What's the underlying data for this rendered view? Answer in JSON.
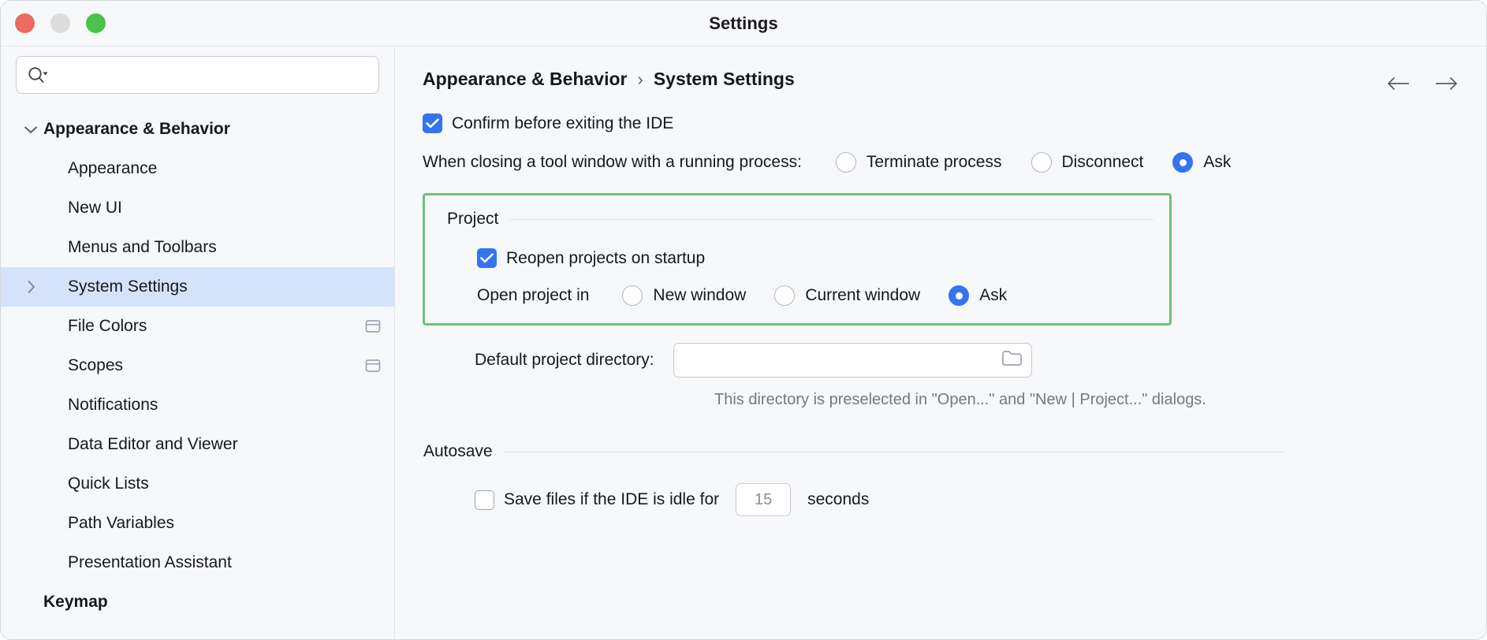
{
  "window": {
    "title": "Settings",
    "controls": {
      "close": "close-button",
      "minimize": "minimize-button",
      "zoom": "zoom-button"
    }
  },
  "sidebar": {
    "search": {
      "value": "",
      "placeholder": ""
    },
    "items": [
      {
        "label": "Appearance & Behavior",
        "level": 0,
        "bold": true,
        "twisty": "chevron-down",
        "selected": false,
        "badge": null
      },
      {
        "label": "Appearance",
        "level": 1,
        "bold": false,
        "twisty": null,
        "selected": false,
        "badge": null
      },
      {
        "label": "New UI",
        "level": 1,
        "bold": false,
        "twisty": null,
        "selected": false,
        "badge": null
      },
      {
        "label": "Menus and Toolbars",
        "level": 1,
        "bold": false,
        "twisty": null,
        "selected": false,
        "badge": null
      },
      {
        "label": "System Settings",
        "level": 1,
        "bold": false,
        "twisty": "chevron-right",
        "selected": true,
        "badge": null
      },
      {
        "label": "File Colors",
        "level": 1,
        "bold": false,
        "twisty": null,
        "selected": false,
        "badge": "project-scope"
      },
      {
        "label": "Scopes",
        "level": 1,
        "bold": false,
        "twisty": null,
        "selected": false,
        "badge": "project-scope"
      },
      {
        "label": "Notifications",
        "level": 1,
        "bold": false,
        "twisty": null,
        "selected": false,
        "badge": null
      },
      {
        "label": "Data Editor and Viewer",
        "level": 1,
        "bold": false,
        "twisty": null,
        "selected": false,
        "badge": null
      },
      {
        "label": "Quick Lists",
        "level": 1,
        "bold": false,
        "twisty": null,
        "selected": false,
        "badge": null
      },
      {
        "label": "Path Variables",
        "level": 1,
        "bold": false,
        "twisty": null,
        "selected": false,
        "badge": null
      },
      {
        "label": "Presentation Assistant",
        "level": 1,
        "bold": false,
        "twisty": null,
        "selected": false,
        "badge": null
      },
      {
        "label": "Keymap",
        "level": 0,
        "bold": true,
        "twisty": null,
        "selected": false,
        "badge": null
      }
    ]
  },
  "breadcrumb": {
    "parent": "Appearance & Behavior",
    "separator": "›",
    "current": "System Settings"
  },
  "nav": {
    "back": "back-arrow",
    "forward": "forward-arrow"
  },
  "main": {
    "confirm_exit": {
      "label": "Confirm before exiting the IDE",
      "checked": true
    },
    "tool_window": {
      "label": "When closing a tool window with a running process:",
      "options": [
        {
          "label": "Terminate process",
          "selected": false
        },
        {
          "label": "Disconnect",
          "selected": false
        },
        {
          "label": "Ask",
          "selected": true
        }
      ]
    },
    "project_section": {
      "title": "Project",
      "highlighted": true,
      "highlight_color": "#6cc17e",
      "reopen": {
        "label": "Reopen projects on startup",
        "checked": true
      },
      "open_in": {
        "label": "Open project in",
        "options": [
          {
            "label": "New window",
            "selected": false
          },
          {
            "label": "Current window",
            "selected": false
          },
          {
            "label": "Ask",
            "selected": true
          }
        ]
      }
    },
    "default_dir": {
      "label": "Default project directory:",
      "value": "",
      "placeholder": "",
      "browse_icon": "folder-icon",
      "hint": "This directory is preselected in \"Open...\" and \"New | Project...\" dialogs."
    },
    "autosave": {
      "title": "Autosave",
      "save_idle": {
        "label_before": "Save files if the IDE is idle for",
        "value": "15",
        "label_after": "seconds",
        "checked": false
      }
    }
  },
  "colors": {
    "accent": "#3574f0",
    "highlight": "#6cc17e",
    "selection": "#d4e2fc",
    "panel": "#f7f8fa"
  }
}
